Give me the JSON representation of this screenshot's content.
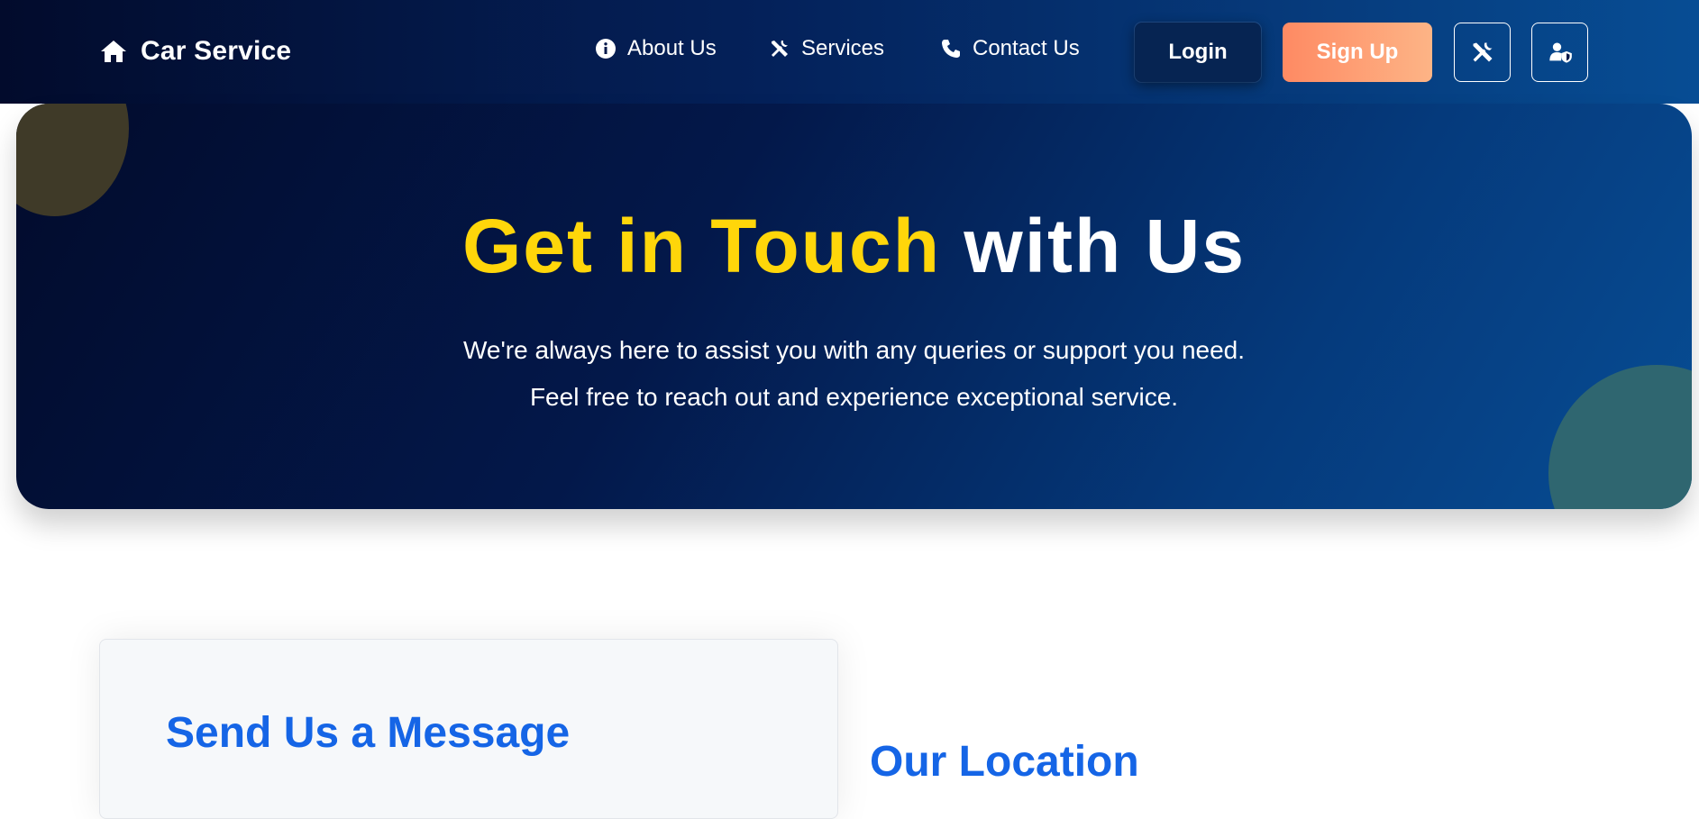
{
  "navbar": {
    "brand": {
      "label": "Car Service",
      "icon": "home-icon"
    },
    "links": [
      {
        "label": "About Us",
        "icon": "info-icon"
      },
      {
        "label": "Services",
        "icon": "tools-icon"
      },
      {
        "label": "Contact Us",
        "icon": "phone-icon"
      }
    ],
    "login_label": "Login",
    "signup_label": "Sign Up",
    "icon_buttons": [
      {
        "icon": "tools-icon"
      },
      {
        "icon": "user-shield-icon"
      }
    ]
  },
  "hero": {
    "title_accent": "Get in Touch",
    "title_rest": "with Us",
    "subtitle_line1": "We're always here to assist you with any queries or support you need.",
    "subtitle_line2": "Feel free to reach out and experience exceptional service."
  },
  "contact": {
    "form_title": "Send Us a Message",
    "location_title": "Our Location"
  },
  "colors": {
    "nav_dark": "#020b2c",
    "nav_blue": "#074d94",
    "accent_yellow": "#ffd60a",
    "signup_orange": "#fe8a63",
    "heading_blue": "#1565e6"
  }
}
